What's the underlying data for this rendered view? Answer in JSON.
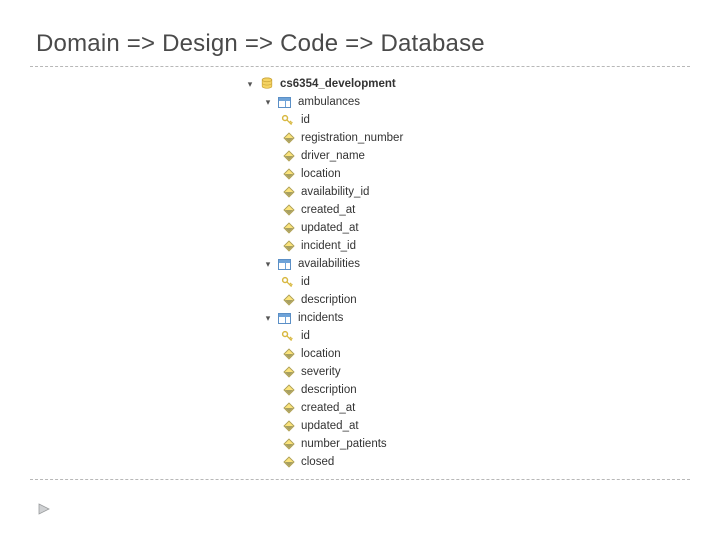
{
  "title": "Domain => Design => Code => Database",
  "tree": {
    "database": {
      "name": "cs6354_development",
      "tables": [
        {
          "name": "ambulances",
          "columns": [
            {
              "name": "id",
              "key": true
            },
            {
              "name": "registration_number",
              "key": false
            },
            {
              "name": "driver_name",
              "key": false
            },
            {
              "name": "location",
              "key": false
            },
            {
              "name": "availability_id",
              "key": false
            },
            {
              "name": "created_at",
              "key": false
            },
            {
              "name": "updated_at",
              "key": false
            },
            {
              "name": "incident_id",
              "key": false
            }
          ]
        },
        {
          "name": "availabilities",
          "columns": [
            {
              "name": "id",
              "key": true
            },
            {
              "name": "description",
              "key": false
            }
          ]
        },
        {
          "name": "incidents",
          "columns": [
            {
              "name": "id",
              "key": true
            },
            {
              "name": "location",
              "key": false
            },
            {
              "name": "severity",
              "key": false
            },
            {
              "name": "description",
              "key": false
            },
            {
              "name": "created_at",
              "key": false
            },
            {
              "name": "updated_at",
              "key": false
            },
            {
              "name": "number_patients",
              "key": false
            },
            {
              "name": "closed",
              "key": false
            }
          ]
        }
      ]
    }
  }
}
